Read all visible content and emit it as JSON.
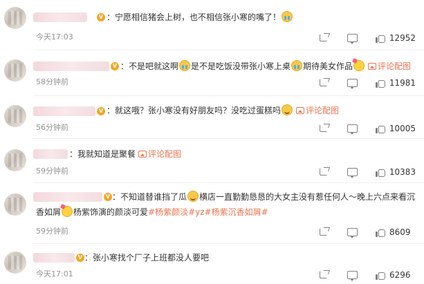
{
  "comments": [
    {
      "name": "",
      "segments": [
        "：宁愿相信猪会上树，也不相信张小寒的嘴了！"
      ],
      "emoji_after": "cry-emoji",
      "has_pic": false,
      "time": "今天17:03",
      "likes": "12952"
    },
    {
      "name": "",
      "segments": [
        "：不是吧就这啊",
        "是不是吃饭没带张小寒上桌",
        "期待美女作品"
      ],
      "has_pic": true,
      "pic_label": "评论配图",
      "time": "58分钟前",
      "likes": "11981"
    },
    {
      "name": "",
      "segments": [
        "：就这哦？张小寒没有好朋友吗？没吃过蛋糕吗"
      ],
      "has_pic": true,
      "pic_label": "评论配图",
      "time": "56分钟前",
      "likes": "10005"
    },
    {
      "name": "",
      "segments": [
        "：我就知道是聚餐"
      ],
      "has_pic": true,
      "pic_label": "评论配图",
      "time": "59分钟前",
      "likes": "10383"
    },
    {
      "name": "",
      "segments": [
        "：不知道替谁挡了瓜",
        "横店一直勤勤恳恳的大女主没有惹任何人～晚上六点来看沉香如屑",
        "杨紫饰演的颜淡可爱"
      ],
      "hashtags": "#杨紫颜淡#yz#杨紫沉香如屑#",
      "time": "59分钟前",
      "likes": "8609"
    },
    {
      "name": "",
      "segments": [
        "：张小寒找个厂子上班都没人要吧"
      ],
      "time": "今天17:01",
      "likes": "6296"
    }
  ],
  "icons": {
    "share": "share-icon",
    "comment": "comment-icon",
    "like": "like-icon"
  },
  "colors": {
    "link": "#eb7350",
    "time": "#939393",
    "text": "#333333"
  }
}
